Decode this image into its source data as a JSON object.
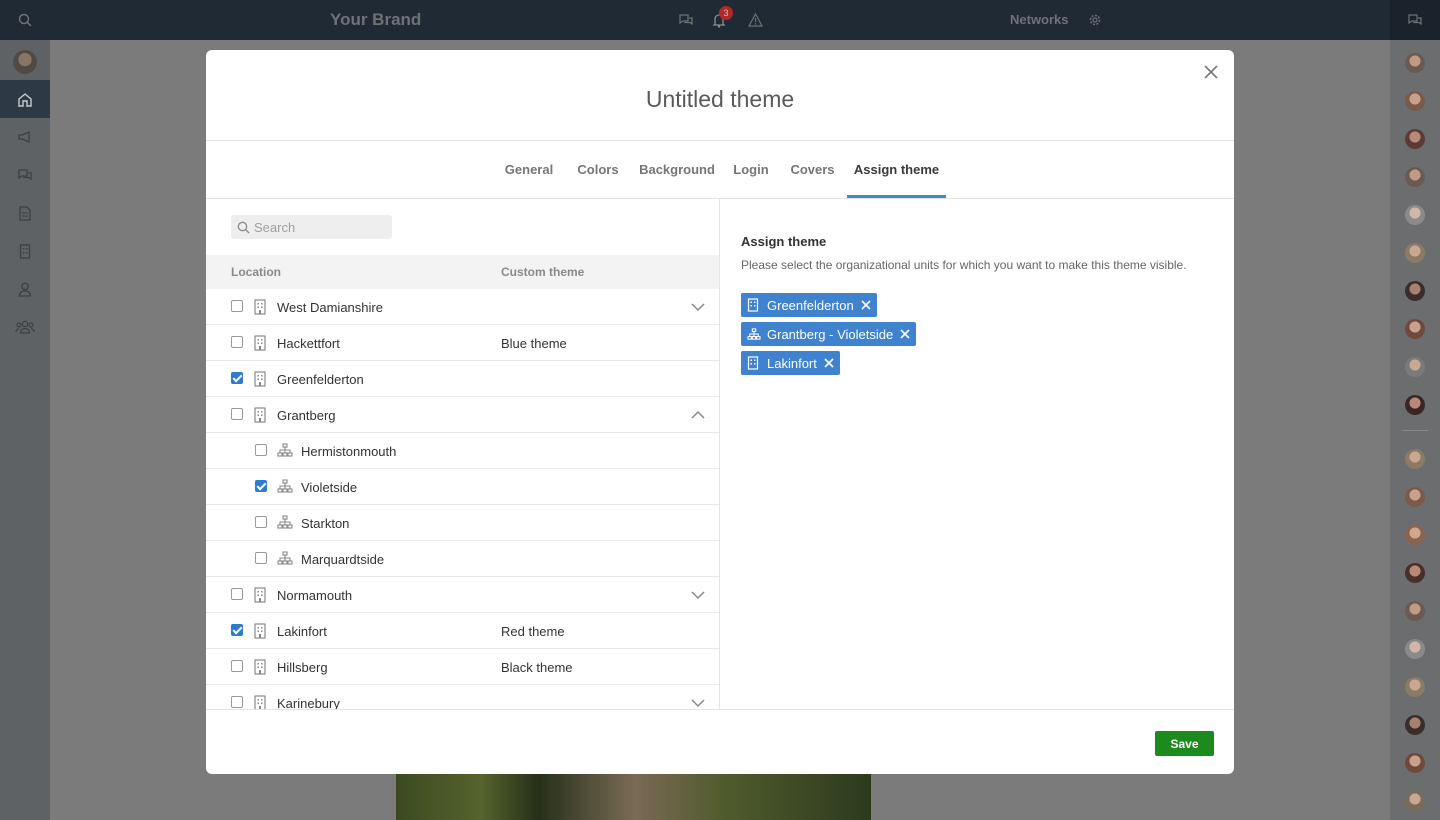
{
  "app": {
    "brand": "Your Brand",
    "notification_count": "3",
    "networks_label": "Networks"
  },
  "modal": {
    "title": "Untitled theme",
    "tabs": [
      {
        "label": "General"
      },
      {
        "label": "Colors"
      },
      {
        "label": "Background"
      },
      {
        "label": "Login"
      },
      {
        "label": "Covers"
      },
      {
        "label": "Assign theme",
        "active": true
      }
    ],
    "search": {
      "placeholder": "Search",
      "value": ""
    },
    "columns": {
      "location": "Location",
      "custom_theme": "Custom theme"
    },
    "rows": [
      {
        "name": "West Damianshire",
        "theme": "",
        "checked": false,
        "icon": "building-icon",
        "toggle": "chevron-down-icon"
      },
      {
        "name": "Hackettfort",
        "theme": "Blue theme",
        "checked": false,
        "icon": "building-icon"
      },
      {
        "name": "Greenfelderton",
        "theme": "",
        "checked": true,
        "icon": "building-icon"
      },
      {
        "name": "Grantberg",
        "theme": "",
        "checked": false,
        "icon": "building-icon",
        "toggle": "chevron-up-icon"
      },
      {
        "name": "Hermistonmouth",
        "theme": "",
        "checked": false,
        "icon": "org-chart-icon",
        "child": true
      },
      {
        "name": "Violetside",
        "theme": "",
        "checked": true,
        "icon": "org-chart-icon",
        "child": true
      },
      {
        "name": "Starkton",
        "theme": "",
        "checked": false,
        "icon": "org-chart-icon",
        "child": true
      },
      {
        "name": "Marquardtside",
        "theme": "",
        "checked": false,
        "icon": "org-chart-icon",
        "child": true
      },
      {
        "name": "Normamouth",
        "theme": "",
        "checked": false,
        "icon": "building-icon",
        "toggle": "chevron-down-icon"
      },
      {
        "name": "Lakinfort",
        "theme": "Red theme",
        "checked": true,
        "icon": "building-icon"
      },
      {
        "name": "Hillsberg",
        "theme": "Black theme",
        "checked": false,
        "icon": "building-icon"
      },
      {
        "name": "Karinebury",
        "theme": "",
        "checked": false,
        "icon": "building-icon",
        "toggle": "chevron-down-icon"
      }
    ],
    "assign": {
      "title": "Assign theme",
      "description": "Please select the organizational units for which you want to make this theme visible.",
      "chips": [
        {
          "label": "Greenfelderton",
          "icon": "building-icon"
        },
        {
          "label": "Grantberg - Violetside",
          "icon": "org-chart-icon"
        },
        {
          "label": "Lakinfort",
          "icon": "building-icon"
        }
      ]
    },
    "save_label": "Save"
  },
  "colors": {
    "accent": "#3f87d3",
    "chip": "#3f82cf",
    "save": "#1c8a1c"
  }
}
